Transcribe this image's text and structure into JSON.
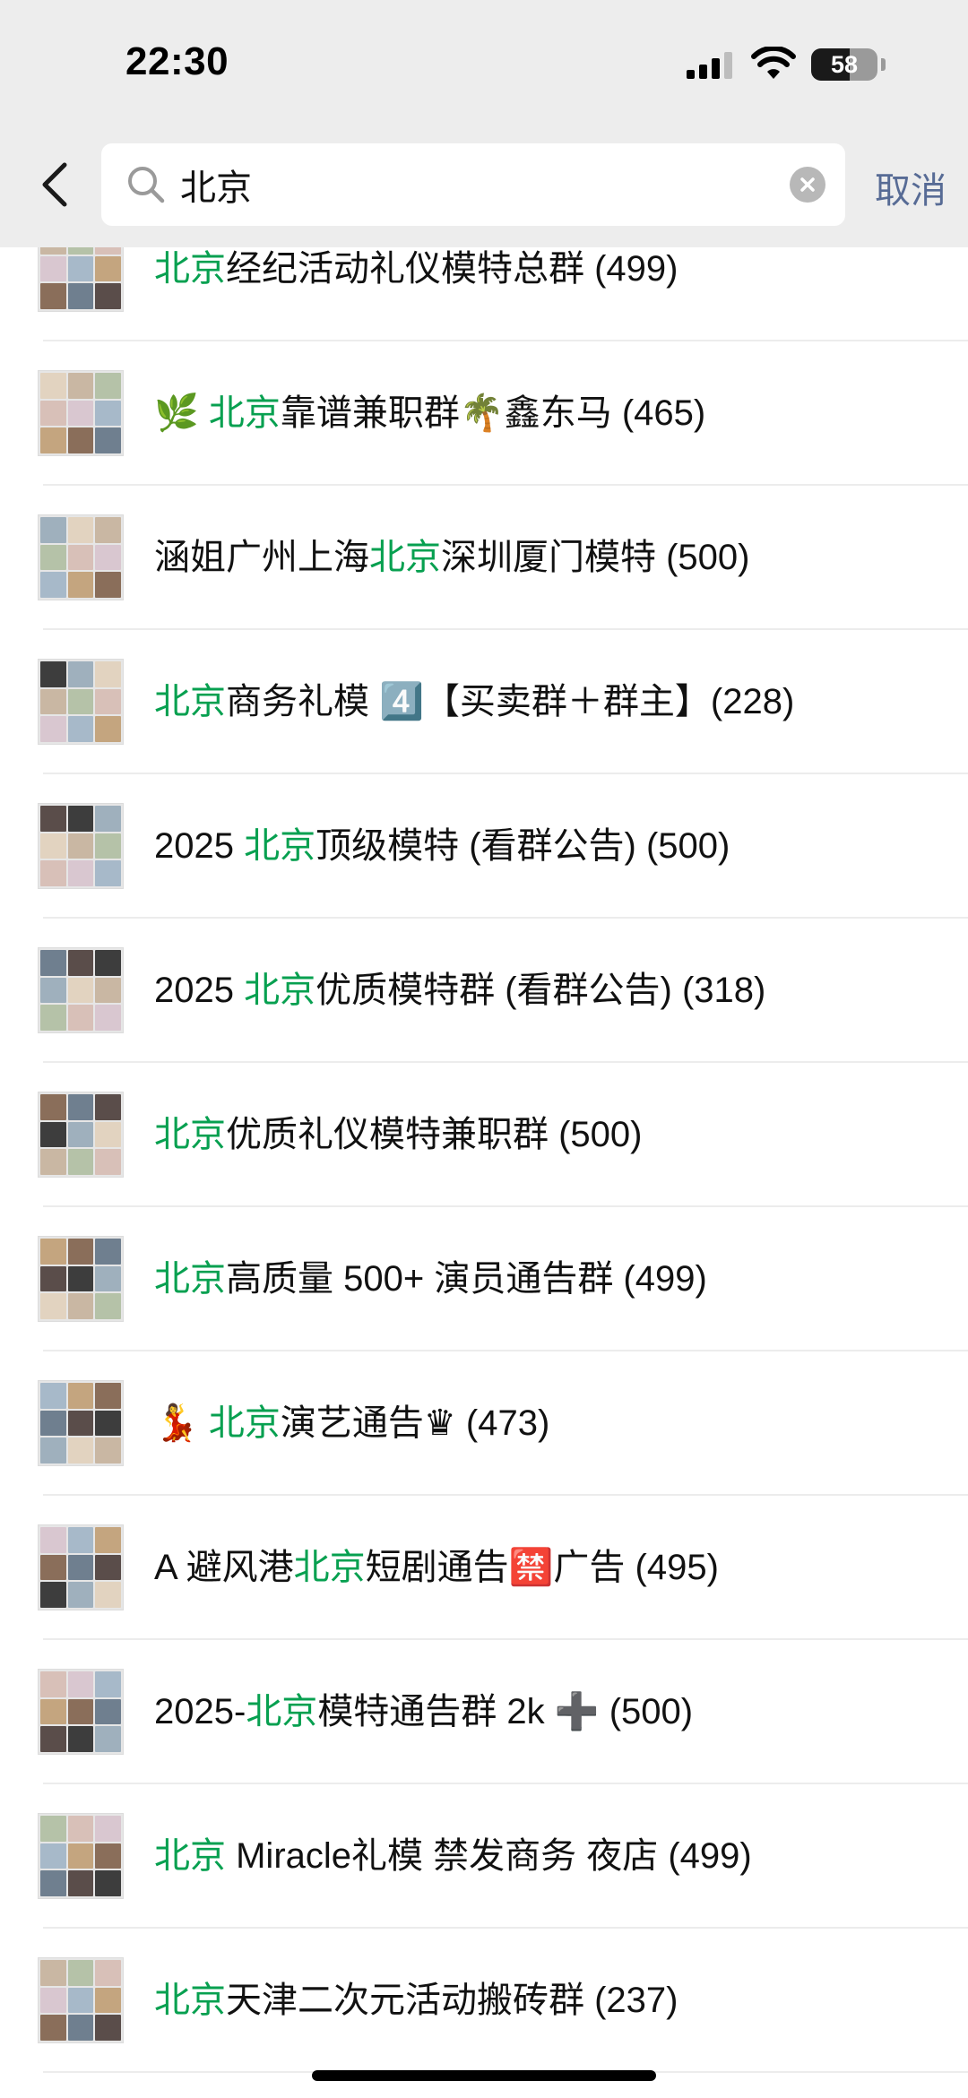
{
  "status_bar": {
    "time": "22:30",
    "battery_level": "58"
  },
  "search": {
    "query": "北京",
    "cancel_label": "取消"
  },
  "results": [
    {
      "before": "",
      "highlight": "北京",
      "after": "经纪活动礼仪模特总群 (499)"
    },
    {
      "before": "🌿 ",
      "highlight": "北京",
      "after": "靠谱兼职群🌴鑫东马 (465)"
    },
    {
      "before": "涵姐广州上海",
      "highlight": "北京",
      "after": "深圳厦门模特 (500)"
    },
    {
      "before": "",
      "highlight": "北京",
      "after": "商务礼模 4️⃣【买卖群＋群主】(228)"
    },
    {
      "before": "2025 ",
      "highlight": "北京",
      "after": "顶级模特 (看群公告) (500)"
    },
    {
      "before": "2025 ",
      "highlight": "北京",
      "after": "优质模特群 (看群公告) (318)"
    },
    {
      "before": "",
      "highlight": "北京",
      "after": "优质礼仪模特兼职群 (500)"
    },
    {
      "before": "",
      "highlight": "北京",
      "after": "高质量 500+ 演员通告群 (499)"
    },
    {
      "before": "💃 ",
      "highlight": "北京",
      "after": "演艺通告♛ (473)"
    },
    {
      "before": "A 避风港",
      "highlight": "北京",
      "after": "短剧通告🈲广告 (495)"
    },
    {
      "before": "2025-",
      "highlight": "北京",
      "after": "模特通告群 2k ➕ (500)"
    },
    {
      "before": "",
      "highlight": "北京",
      "after": " Miracle礼模 禁发商务 夜店 (499)"
    },
    {
      "before": "",
      "highlight": "北京",
      "after": "天津二次元活动搬砖群 (237)"
    }
  ]
}
